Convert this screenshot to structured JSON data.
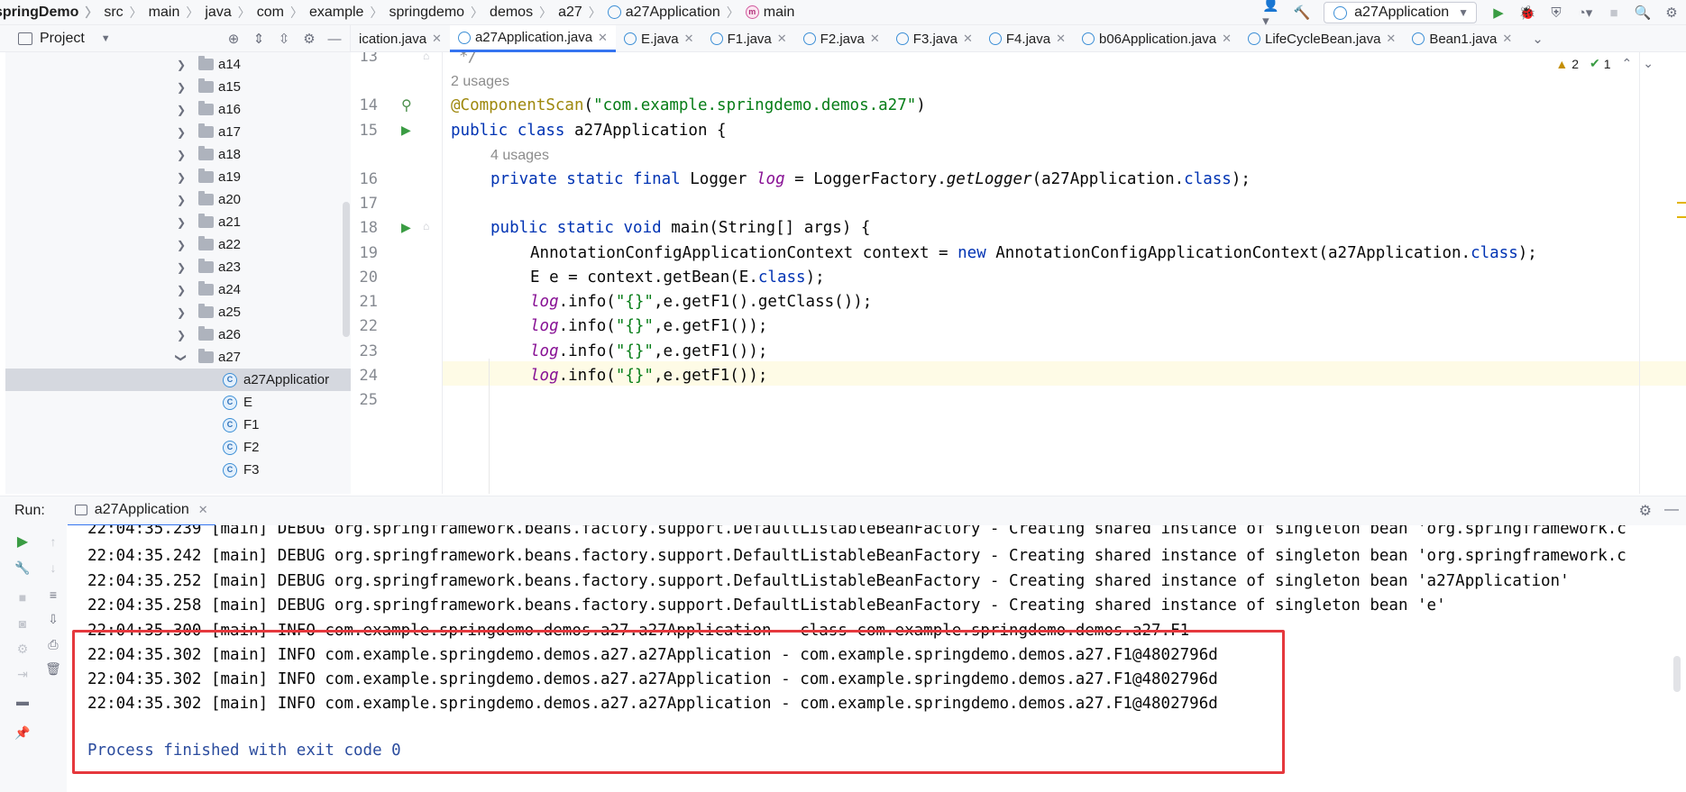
{
  "breadcrumbs": [
    "springDemo",
    "src",
    "main",
    "java",
    "com",
    "example",
    "springdemo",
    "demos",
    "a27",
    "a27Application",
    "main"
  ],
  "run_config": {
    "label": "a27Application"
  },
  "project_panel": {
    "title": "Project"
  },
  "tabs": [
    {
      "label": "ication.java",
      "active": false
    },
    {
      "label": "a27Application.java",
      "active": true
    },
    {
      "label": "E.java",
      "active": false
    },
    {
      "label": "F1.java",
      "active": false
    },
    {
      "label": "F2.java",
      "active": false
    },
    {
      "label": "F3.java",
      "active": false
    },
    {
      "label": "F4.java",
      "active": false
    },
    {
      "label": "b06Application.java",
      "active": false
    },
    {
      "label": "LifeCycleBean.java",
      "active": false
    },
    {
      "label": "Bean1.java",
      "active": false
    }
  ],
  "tree": {
    "folders": [
      "a14",
      "a15",
      "a16",
      "a17",
      "a18",
      "a19",
      "a20",
      "a21",
      "a22",
      "a23",
      "a24",
      "a25",
      "a26",
      "a27"
    ],
    "files": [
      "a27Applicatior",
      "E",
      "F1",
      "F2",
      "F3"
    ]
  },
  "inspections": {
    "warnings": "2",
    "ok": "1"
  },
  "editor": {
    "usages_top": "2 usages",
    "usages_field": "4 usages",
    "line_numbers": [
      "13",
      "14",
      "15",
      "16",
      "17",
      "18",
      "19",
      "20",
      "21",
      "22",
      "23",
      "24",
      "25"
    ],
    "code": {
      "l13": "*/",
      "l14_ann": "@ComponentScan",
      "l14_str": "\"com.example.springdemo.demos.a27\"",
      "l15_a": "public class",
      "l15_b": " a27Application {",
      "l16_a": "private static final",
      "l16_b": " Logger ",
      "l16_c": "log",
      "l16_d": " = LoggerFactory.",
      "l16_e": "getLogger",
      "l16_f": "(a27Application.",
      "l16_g": "class",
      "l16_h": ");",
      "l18_a": "public static void",
      "l18_b": " main(String[] args) {",
      "l19_a": "AnnotationConfigApplicationContext context = ",
      "l19_b": "new",
      "l19_c": " AnnotationConfigApplicationContext(a27Application.",
      "l19_d": "class",
      "l19_e": ");",
      "l20_a": "E e = context.getBean(E.",
      "l20_b": "class",
      "l20_c": ");",
      "log": "log",
      "info_a": ".info(",
      "info_str": "\"{}\"",
      "l21_c": ",e.getF1().getClass());",
      "l22_c": ",e.getF1());"
    }
  },
  "run": {
    "title": "Run:",
    "tab_label": "a27Application",
    "console": [
      "22:04:35.239 [main] DEBUG org.springframework.beans.factory.support.DefaultListableBeanFactory - Creating shared instance of singleton bean 'org.springframework.c",
      "22:04:35.242 [main] DEBUG org.springframework.beans.factory.support.DefaultListableBeanFactory - Creating shared instance of singleton bean 'org.springframework.c",
      "22:04:35.252 [main] DEBUG org.springframework.beans.factory.support.DefaultListableBeanFactory - Creating shared instance of singleton bean 'a27Application'",
      "22:04:35.258 [main] DEBUG org.springframework.beans.factory.support.DefaultListableBeanFactory - Creating shared instance of singleton bean 'e'",
      "22:04:35.300 [main] INFO com.example.springdemo.demos.a27.a27Application - class com.example.springdemo.demos.a27.F1",
      "22:04:35.302 [main] INFO com.example.springdemo.demos.a27.a27Application - com.example.springdemo.demos.a27.F1@4802796d",
      "22:04:35.302 [main] INFO com.example.springdemo.demos.a27.a27Application - com.example.springdemo.demos.a27.F1@4802796d",
      "22:04:35.302 [main] INFO com.example.springdemo.demos.a27.a27Application - com.example.springdemo.demos.a27.F1@4802796d"
    ],
    "exit_line": "Process finished with exit code 0"
  },
  "colors": {
    "accent": "#3574f0",
    "highlight_border": "#e5383d",
    "run_green": "#3a9c43"
  }
}
